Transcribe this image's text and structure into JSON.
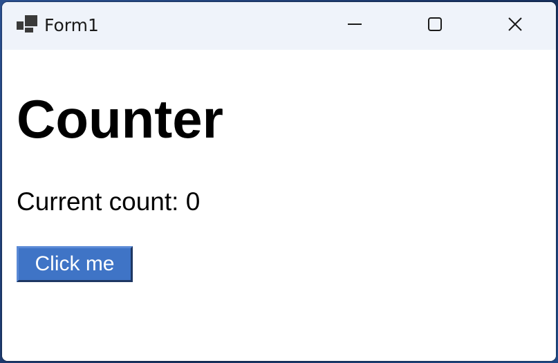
{
  "window": {
    "title": "Form1",
    "icon": "app-window-icon",
    "controls": {
      "minimize_icon": "minimize-icon",
      "maximize_icon": "maximize-icon",
      "close_icon": "close-icon"
    }
  },
  "page": {
    "heading": "Counter",
    "count_label": "Current count: ",
    "count_value": "0",
    "button_label": "Click me"
  },
  "colors": {
    "titlebar_bg": "#eff3fa",
    "button_bg": "#3f74c6",
    "button_border_dark": "#1e3763",
    "content_bg": "#ffffff"
  }
}
